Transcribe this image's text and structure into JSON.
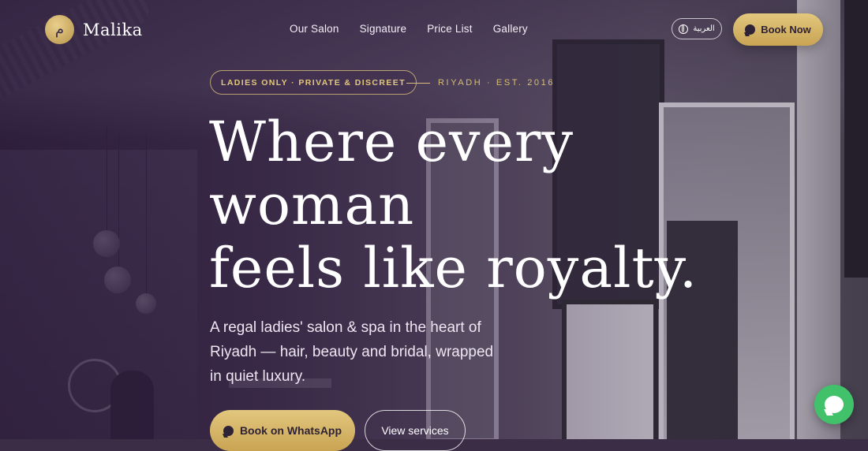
{
  "brand": {
    "monogram": "م",
    "name": "Malika"
  },
  "nav": {
    "items": [
      {
        "label": "Our Salon"
      },
      {
        "label": "Signature"
      },
      {
        "label": "Price List"
      },
      {
        "label": "Gallery"
      }
    ]
  },
  "header": {
    "language_label": "العربية",
    "book_label": "Book Now"
  },
  "hero": {
    "pill": "LADIES ONLY · PRIVATE & DISCREET",
    "tagline": "RIYADH · EST. 2016",
    "headline": [
      "Where every",
      "woman",
      "feels like royalty."
    ],
    "subtitle": "A regal ladies' salon & spa in the heart of Riyadh — hair, beauty and bridal, wrapped in quiet luxury.",
    "cta_primary": "Book on WhatsApp",
    "cta_secondary": "View services"
  },
  "colors": {
    "gold": "#e2c77e",
    "deep_plum": "#2e2236",
    "whatsapp_green": "#41c26a"
  },
  "icons": {
    "language": "globe-icon",
    "book": "chat-bubble-icon",
    "floating": "whatsapp-icon"
  }
}
